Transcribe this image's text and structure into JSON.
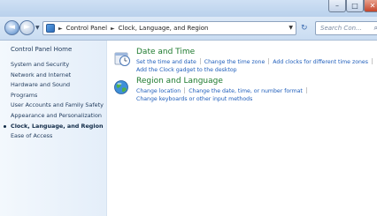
{
  "addressbar": {
    "crumbs": [
      "Control Panel",
      "Clock, Language, and Region"
    ],
    "search_placeholder": "Search Con..."
  },
  "sidebar": {
    "home": "Control Panel Home",
    "items": [
      {
        "label": "System and Security"
      },
      {
        "label": "Network and Internet"
      },
      {
        "label": "Hardware and Sound"
      },
      {
        "label": "Programs"
      },
      {
        "label": "User Accounts and Family Safety"
      },
      {
        "label": "Appearance and Personalization"
      },
      {
        "label": "Clock, Language, and Region",
        "active": true
      },
      {
        "label": "Ease of Access"
      }
    ]
  },
  "categories": [
    {
      "title": "Date and Time",
      "icon": "clock-icon",
      "links": [
        [
          "Set the time and date",
          "Change the time zone",
          "Add clocks for different time zones"
        ],
        [
          "Add the Clock gadget to the desktop"
        ]
      ]
    },
    {
      "title": "Region and Language",
      "icon": "globe-icon",
      "links": [
        [
          "Change location",
          "Change the date, time, or number format"
        ],
        [
          "Change keyboards or other input methods"
        ]
      ]
    }
  ],
  "colors": {
    "category_title": "#1e7a2e",
    "link": "#1f5ebb",
    "sidebar_text": "#1e395b"
  }
}
